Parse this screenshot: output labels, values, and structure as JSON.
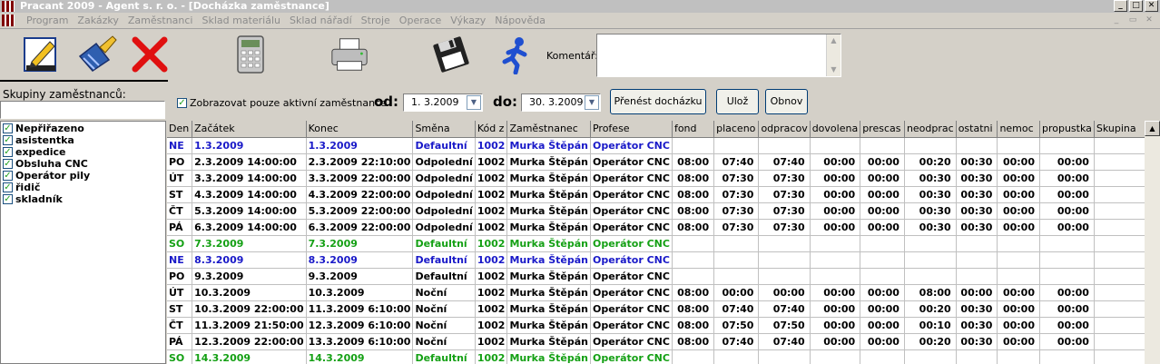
{
  "window": {
    "title": "Pracant 2009 - Agent s. r. o. - [Docházka zaměstnance]"
  },
  "menu": [
    "Program",
    "Zakázky",
    "Zaměstnanci",
    "Sklad materiálu",
    "Sklad nářadí",
    "Stroje",
    "Operace",
    "Výkazy",
    "Nápověda"
  ],
  "toolbar": {
    "comment_label": "Komentář:",
    "comment_value": ""
  },
  "groups": {
    "title": "Skupiny zaměstnanců:",
    "search_value": "",
    "items": [
      "Nepřiřazeno",
      "asistentka",
      "expedice",
      "Obsluha CNC",
      "Operátor pily",
      "řidič",
      "skladník"
    ]
  },
  "filter": {
    "active_only_label": "Zobrazovat pouze aktivní zaměstnance",
    "from_label": "od:",
    "from_value": "1. 3.2009",
    "to_label": "do:",
    "to_value": "30. 3.2009",
    "transfer_button": "Přenést docházku",
    "save_button": "Ulož",
    "refresh_button": "Obnov"
  },
  "table": {
    "columns": [
      "Den",
      "Začátek",
      "Konec",
      "Směna",
      "Kód z",
      "Zaměstnanec",
      "Profese",
      "fond",
      "placeno",
      "odpracov",
      "dovolena",
      "prescas",
      "neodprac",
      "ostatni",
      "nemoc",
      "propustka",
      "Skupina"
    ],
    "rows": [
      {
        "type": "default",
        "cells": [
          "NE",
          "1.3.2009",
          "1.3.2009",
          "Defaultní",
          "1002",
          "Murka Štěpán",
          "Operátor CNC",
          "",
          "",
          "",
          "",
          "",
          "",
          "",
          "",
          "",
          ""
        ]
      },
      {
        "type": "work",
        "cells": [
          "PO",
          "2.3.2009 14:00:00",
          "2.3.2009 22:10:00",
          "Odpolední",
          "1002",
          "Murka Štěpán",
          "Operátor CNC",
          "08:00",
          "07:40",
          "07:40",
          "00:00",
          "00:00",
          "00:20",
          "00:30",
          "00:00",
          "00:00",
          ""
        ]
      },
      {
        "type": "work",
        "cells": [
          "ÚT",
          "3.3.2009 14:00:00",
          "3.3.2009 22:00:00",
          "Odpolední",
          "1002",
          "Murka Štěpán",
          "Operátor CNC",
          "08:00",
          "07:30",
          "07:30",
          "00:00",
          "00:00",
          "00:30",
          "00:30",
          "00:00",
          "00:00",
          ""
        ]
      },
      {
        "type": "work",
        "cells": [
          "ST",
          "4.3.2009 14:00:00",
          "4.3.2009 22:00:00",
          "Odpolední",
          "1002",
          "Murka Štěpán",
          "Operátor CNC",
          "08:00",
          "07:30",
          "07:30",
          "00:00",
          "00:00",
          "00:30",
          "00:30",
          "00:00",
          "00:00",
          ""
        ]
      },
      {
        "type": "work",
        "cells": [
          "ČT",
          "5.3.2009 14:00:00",
          "5.3.2009 22:00:00",
          "Odpolední",
          "1002",
          "Murka Štěpán",
          "Operátor CNC",
          "08:00",
          "07:30",
          "07:30",
          "00:00",
          "00:00",
          "00:30",
          "00:30",
          "00:00",
          "00:00",
          ""
        ]
      },
      {
        "type": "work",
        "cells": [
          "PÁ",
          "6.3.2009 14:00:00",
          "6.3.2009 22:00:00",
          "Odpolední",
          "1002",
          "Murka Štěpán",
          "Operátor CNC",
          "08:00",
          "07:30",
          "07:30",
          "00:00",
          "00:00",
          "00:30",
          "00:30",
          "00:00",
          "00:00",
          ""
        ]
      },
      {
        "type": "so",
        "cells": [
          "SO",
          "7.3.2009",
          "7.3.2009",
          "Defaultní",
          "1002",
          "Murka Štěpán",
          "Operátor CNC",
          "",
          "",
          "",
          "",
          "",
          "",
          "",
          "",
          "",
          ""
        ]
      },
      {
        "type": "default",
        "cells": [
          "NE",
          "8.3.2009",
          "8.3.2009",
          "Defaultní",
          "1002",
          "Murka Štěpán",
          "Operátor CNC",
          "",
          "",
          "",
          "",
          "",
          "",
          "",
          "",
          "",
          ""
        ]
      },
      {
        "type": "work",
        "cells": [
          "PO",
          "9.3.2009",
          "9.3.2009",
          "Defaultní",
          "1002",
          "Murka Štěpán",
          "Operátor CNC",
          "",
          "",
          "",
          "",
          "",
          "",
          "",
          "",
          "",
          ""
        ]
      },
      {
        "type": "work",
        "cells": [
          "ÚT",
          "10.3.2009",
          "10.3.2009",
          "Noční",
          "1002",
          "Murka Štěpán",
          "Operátor CNC",
          "08:00",
          "00:00",
          "00:00",
          "00:00",
          "00:00",
          "08:00",
          "00:00",
          "00:00",
          "00:00",
          ""
        ]
      },
      {
        "type": "work",
        "cells": [
          "ST",
          "10.3.2009 22:00:00",
          "11.3.2009 6:10:00",
          "Noční",
          "1002",
          "Murka Štěpán",
          "Operátor CNC",
          "08:00",
          "07:40",
          "07:40",
          "00:00",
          "00:00",
          "00:20",
          "00:30",
          "00:00",
          "00:00",
          ""
        ]
      },
      {
        "type": "work",
        "cells": [
          "ČT",
          "11.3.2009 21:50:00",
          "12.3.2009 6:10:00",
          "Noční",
          "1002",
          "Murka Štěpán",
          "Operátor CNC",
          "08:00",
          "07:50",
          "07:50",
          "00:00",
          "00:00",
          "00:10",
          "00:30",
          "00:00",
          "00:00",
          ""
        ]
      },
      {
        "type": "work",
        "cells": [
          "PÁ",
          "12.3.2009 22:00:00",
          "13.3.2009 6:10:00",
          "Noční",
          "1002",
          "Murka Štěpán",
          "Operátor CNC",
          "08:00",
          "07:40",
          "07:40",
          "00:00",
          "00:00",
          "00:20",
          "00:30",
          "00:00",
          "00:00",
          ""
        ]
      },
      {
        "type": "so",
        "cells": [
          "SO",
          "14.3.2009",
          "14.3.2009",
          "Defaultní",
          "1002",
          "Murka Štěpán",
          "Operátor CNC",
          "",
          "",
          "",
          "",
          "",
          "",
          "",
          "",
          "",
          ""
        ]
      }
    ]
  },
  "colors": {
    "default_row": "#1919c8",
    "saturday_row": "#14a014",
    "work_row": "#000000"
  },
  "icons": [
    "edit-icon",
    "broom-icon",
    "delete-icon",
    "calculator-icon",
    "printer-icon",
    "floppy-save-icon",
    "running-man-icon"
  ]
}
